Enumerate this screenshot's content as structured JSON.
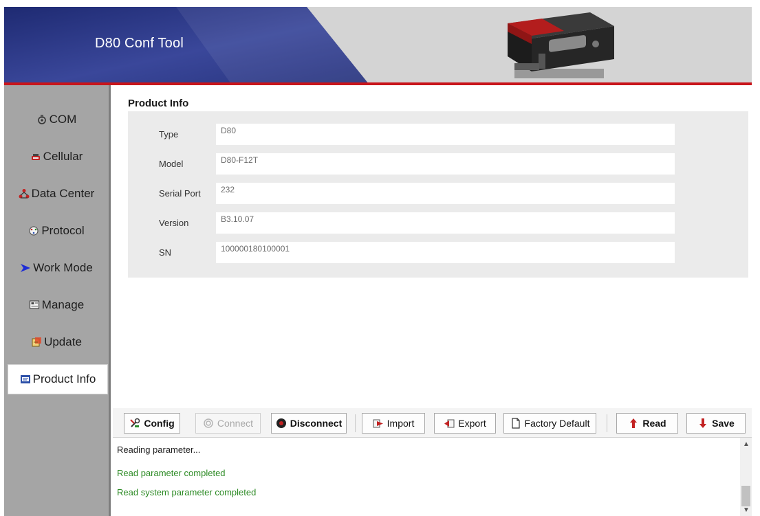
{
  "header": {
    "title": "D80 Conf Tool",
    "brand_blue": "#25307a",
    "accent_red": "#c8151b"
  },
  "sidebar": {
    "items": [
      {
        "label": "COM",
        "icon": "com-port-icon"
      },
      {
        "label": "Cellular",
        "icon": "cellular-icon"
      },
      {
        "label": "Data Center",
        "icon": "data-center-icon"
      },
      {
        "label": "Protocol",
        "icon": "protocol-icon"
      },
      {
        "label": "Work Mode",
        "icon": "work-mode-arrow-icon"
      },
      {
        "label": "Manage",
        "icon": "manage-icon"
      },
      {
        "label": "Update",
        "icon": "update-icon"
      },
      {
        "label": "Product Info",
        "icon": "product-info-icon"
      }
    ],
    "active": "Product Info"
  },
  "main": {
    "section_title": "Product Info",
    "fields": [
      {
        "label": "Type",
        "value": "D80"
      },
      {
        "label": "Model",
        "value": "D80-F12T"
      },
      {
        "label": "Serial Port",
        "value": "232"
      },
      {
        "label": "Version",
        "value": "B3.10.07"
      },
      {
        "label": "SN",
        "value": "100000180100001"
      }
    ]
  },
  "toolbar": {
    "config": "Config",
    "connect": "Connect",
    "disconnect": "Disconnect",
    "import": "Import",
    "export": "Export",
    "factory_default": "Factory Default",
    "read": "Read",
    "save": "Save"
  },
  "log": {
    "lines": [
      {
        "text": "Reading parameter...",
        "color": "#222222"
      },
      {
        "text": "Read parameter completed",
        "color": "#2c8a24"
      },
      {
        "text": "Read system parameter completed",
        "color": "#2c8a24"
      }
    ]
  }
}
